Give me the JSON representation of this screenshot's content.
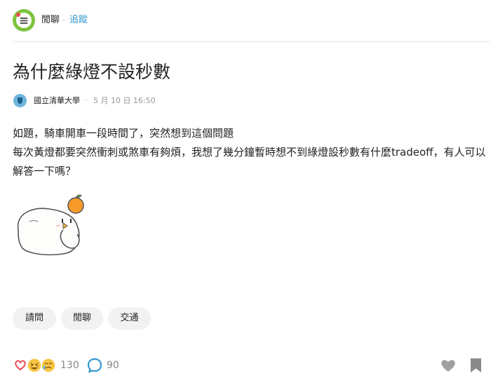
{
  "header": {
    "board_name": "閒聊",
    "separator": "·",
    "follow_label": "追蹤"
  },
  "post": {
    "title": "為什麼綠燈不設秒數",
    "author": "國立清華大學",
    "separator": "·",
    "time": "5 月 10 日 16:50",
    "body_lines": [
      "如題，騎車開車一段時間了，突然想到這個問題",
      "每次黃燈都要突然衝刺或煞車有夠煩，我想了幾分鐘暫時想不到綠燈設秒數有什麼tradeoff，有人可以解答一下嗎？"
    ]
  },
  "tags": [
    "請問",
    "閒聊",
    "交通"
  ],
  "footer": {
    "reaction_count": "130",
    "comment_count": "90"
  },
  "colors": {
    "accent": "#3397cf",
    "board_icon": "#7cc33f",
    "tag_bg": "#f2f2f2",
    "icon_gray": "#a0a0a0",
    "comment_blue": "#3397cf"
  },
  "icons": {
    "board": "chat-list-icon",
    "reactions": [
      "heart-icon",
      "haha-icon",
      "cry-icon"
    ],
    "comment": "comment-bubble-icon",
    "like": "heart-outline-icon",
    "bookmark": "bookmark-icon"
  }
}
